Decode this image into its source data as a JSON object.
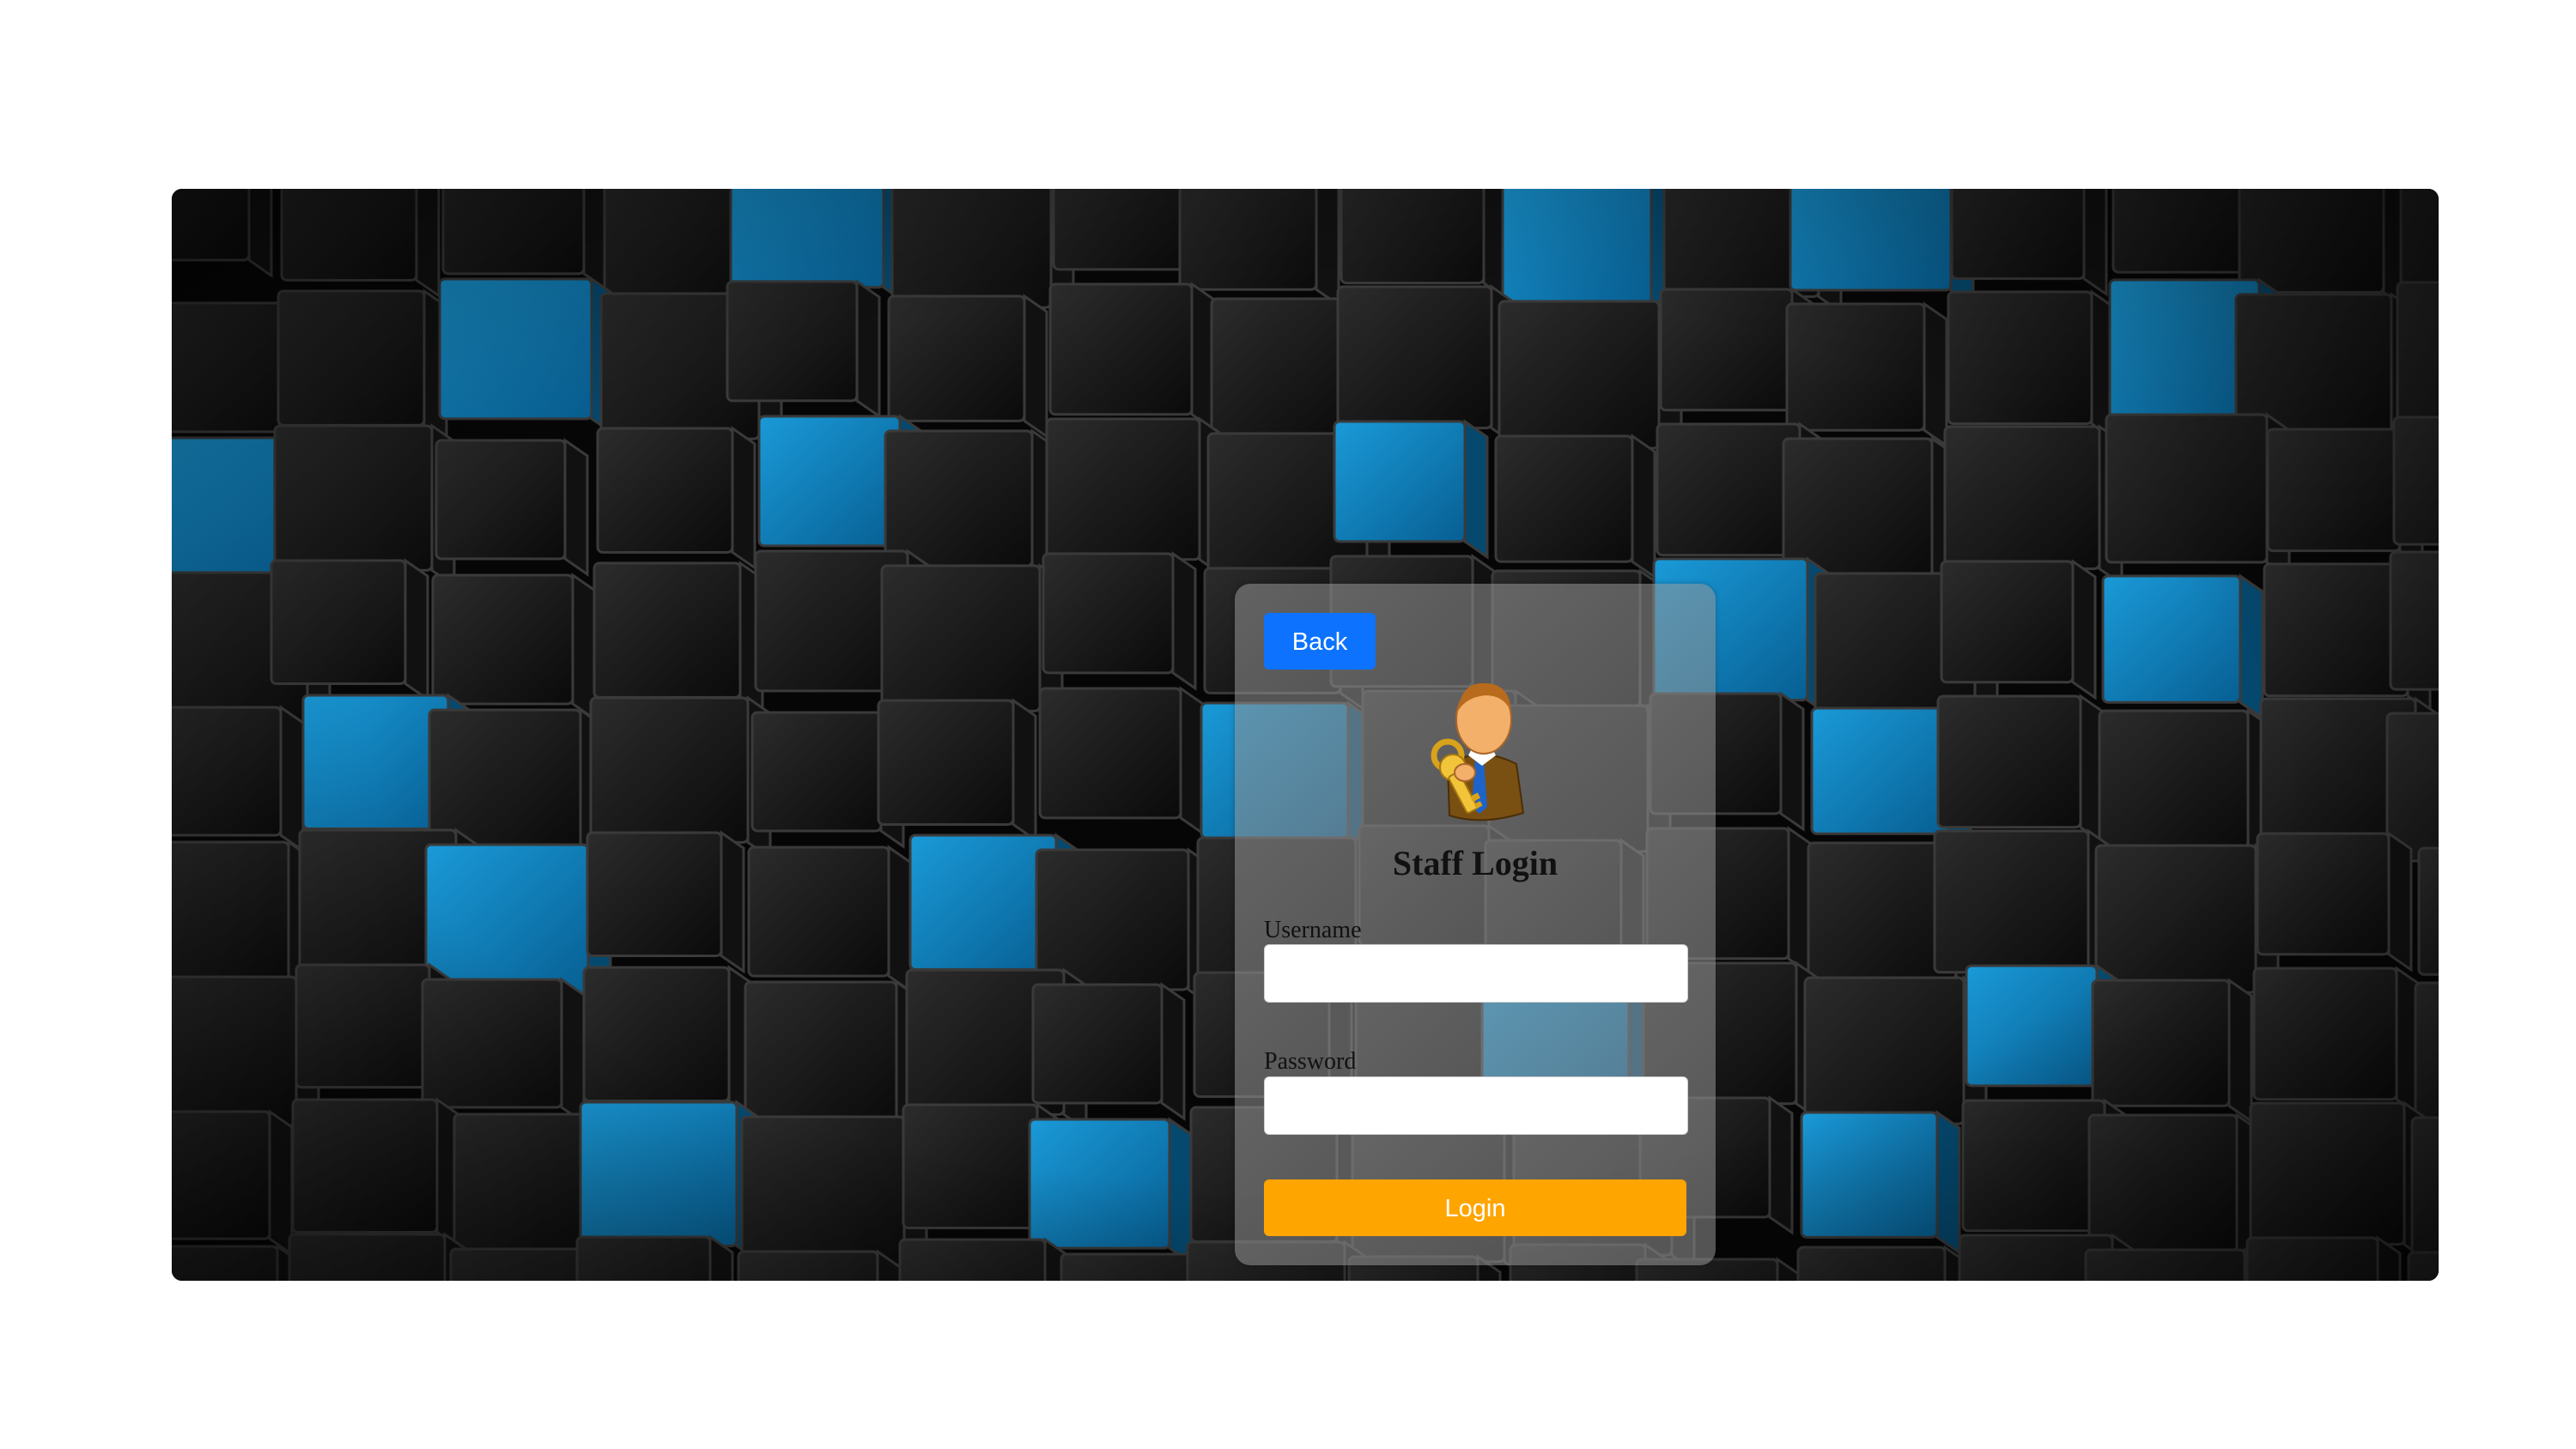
{
  "login": {
    "back_label": "Back",
    "title": "Staff Login",
    "username_label": "Username",
    "username_value": "",
    "password_label": "Password",
    "password_value": "",
    "login_label": "Login",
    "avatar_icon": "staff-with-keys-icon"
  },
  "colors": {
    "back_button": "#0d73ff",
    "login_button": "#ffa500",
    "cube_accent": "#0a86c8"
  }
}
